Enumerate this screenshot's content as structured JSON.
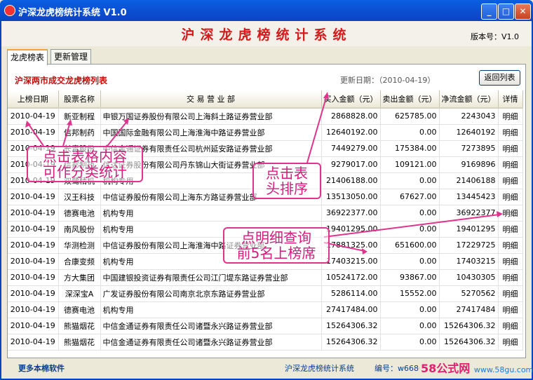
{
  "window": {
    "title": "沪深龙虎榜统计系统  V1.0",
    "minimize": "_",
    "maximize": "□",
    "close": "✕"
  },
  "header": {
    "app_title": "沪深龙虎榜统计系统",
    "version": "版本号：V1.0"
  },
  "tabs": [
    {
      "label": "龙虎榜表",
      "active": true
    },
    {
      "label": "更新管理",
      "active": false
    }
  ],
  "panel": {
    "list_title": "沪深两市成交龙虎榜列表",
    "update_date": "更新日期：（2010-04-19）",
    "return_button": "返回列表"
  },
  "table": {
    "columns": [
      "上榜日期",
      "股票名称",
      "交 易 营 业 部",
      "买入金额（元）",
      "卖出金额（元）",
      "净流金额（元）",
      "详情"
    ],
    "rows": [
      [
        "2010-04-19",
        "新亚制程",
        "申银万国证券股份有限公司上海斜土路证券营业部",
        "2868828.00",
        "625785.00",
        "2243043",
        "明细"
      ],
      [
        "2010-04-19",
        "信邦制药",
        "中国国际金融有限公司上海淮海中路证券营业部",
        "12640192.00",
        "0.00",
        "12640192",
        "明细"
      ],
      [
        "2010-04-19",
        "长青股份",
        "中信金通证券有限责任公司杭州延安路证券营业部",
        "7449279.00",
        "175384.00",
        "7273895",
        "明细"
      ],
      [
        "2010-04-19",
        "信邦制药",
        "信达证券股份有限公司丹东锦山大街证券营业部",
        "9279017.00",
        "109121.00",
        "9169896",
        "明细"
      ],
      [
        "2010-04-19",
        "双鹭精机",
        "机构专用",
        "21406188.00",
        "0.00",
        "21406188",
        "明细"
      ],
      [
        "2010-04-19",
        "汉王科技",
        "中信证券股份有限公司上海东方路证券营业部",
        "13513050.00",
        "67627.00",
        "13445423",
        "明细"
      ],
      [
        "2010-04-19",
        "德赛电池",
        "机构专用",
        "36922377.00",
        "0.00",
        "36922377",
        "明细"
      ],
      [
        "2010-04-19",
        "南风股份",
        "机构专用",
        "19401295.00",
        "0.00",
        "19401295",
        "明细"
      ],
      [
        "2010-04-19",
        "华测检测",
        "中信证券股份有限公司上海淮海中路证券营业部",
        "17881325.00",
        "651600.00",
        "17229725",
        "明细"
      ],
      [
        "2010-04-19",
        "合康变频",
        "机构专用",
        "17403215.00",
        "0.00",
        "17403215",
        "明细"
      ],
      [
        "2010-04-19",
        "方大集团",
        "中国建银投资证券有限责任公司江门堤东路证券营业部",
        "10524172.00",
        "93867.00",
        "10430305",
        "明细"
      ],
      [
        "2010-04-19",
        "深深宝A",
        "广发证券股份有限公司南京北京东路证券营业部",
        "5286114.00",
        "15552.00",
        "5270562",
        "明细"
      ],
      [
        "2010-04-19",
        "德赛电池",
        "机构专用",
        "27417484.00",
        "0.00",
        "27417484",
        "明细"
      ],
      [
        "2010-04-19",
        "熊猫烟花",
        "中信金通证券有限责任公司诸暨永兴路证券营业部",
        "15264306.32",
        "0.00",
        "15264306.32",
        "明细"
      ],
      [
        "2010-04-19",
        "熊猫烟花",
        "中信金通证券有限责任公司诸暨永兴路证券营业部",
        "15264306.32",
        "0.00",
        "15264306.32",
        "明细"
      ]
    ]
  },
  "annotations": {
    "classify": [
      "点击表格内容",
      "可作分类统计"
    ],
    "sort": [
      "点击表",
      "头排序"
    ],
    "detail": [
      "点明细查询",
      "前5名上榜席"
    ]
  },
  "footer": {
    "more": "更多本棉软件",
    "app_name": "沪深龙虎榜统计系统",
    "code": "编号：w6686"
  },
  "watermark": {
    "brand": "58公式网",
    "url": "www.58gu.com"
  },
  "colors": {
    "title_red": "#D41A1A",
    "annotation_pink": "#E0338C",
    "titlebar_blue": "#0A5FE0"
  }
}
